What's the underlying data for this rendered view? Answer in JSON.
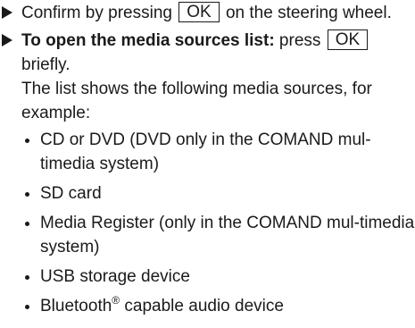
{
  "step1": {
    "text_before": "Confirm by pressing",
    "key": "OK",
    "text_after": "on the steering wheel."
  },
  "step2": {
    "bold": "To open the media sources list:",
    "text_before": " press",
    "key": "OK",
    "text_after": "briefly."
  },
  "intro": "The list shows the following media sources, for example:",
  "sources": [
    {
      "text": "CD or DVD (DVD only in the COMAND mul-timedia system)"
    },
    {
      "text": "SD card"
    },
    {
      "text": "Media Register (only in the COMAND mul-timedia system)"
    },
    {
      "text": "USB storage device"
    },
    {
      "text": "Bluetooth",
      "sup": "®",
      "after": " capable audio device"
    }
  ]
}
